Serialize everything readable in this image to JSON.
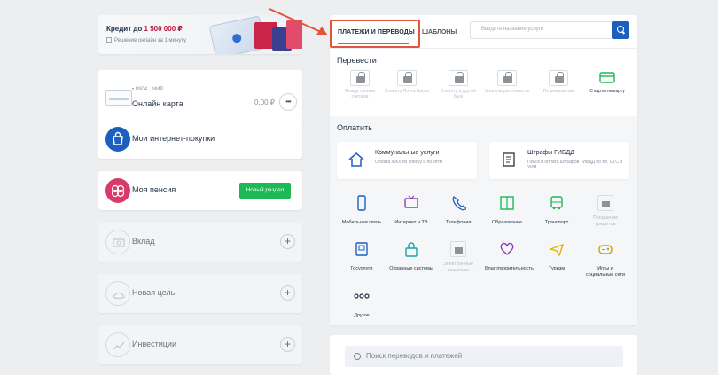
{
  "left": {
    "credit": {
      "title_prefix": "Кредит до ",
      "title_amount": "1 500 000 ₽",
      "subtitle": "Решение онлайн за 1 минуту"
    },
    "card": {
      "number": "• 8904 , МИР",
      "name": "Онлайн карта",
      "balance": "0,00 ₽",
      "more": "•••"
    },
    "purchases": {
      "label": "Мои интернет-покупки"
    },
    "pension": {
      "label": "Моя пенсия",
      "button": "Новый раздел"
    },
    "deposit": {
      "label": "Вклад"
    },
    "goal": {
      "label": "Новая цель"
    },
    "invest": {
      "label": "Инвестиции"
    }
  },
  "right": {
    "tabs": {
      "active": "ПЛАТЕЖИ И ПЕРЕВОДЫ",
      "second": "ШАБЛОНЫ"
    },
    "search_placeholder": "Введите название услуги",
    "transfer_title": "Перевести",
    "transfers": [
      {
        "label": "Между своими счетами"
      },
      {
        "label": "Клиенту Почта Банка"
      },
      {
        "label": "Клиенту в другой банк"
      },
      {
        "label": "Благотворительность"
      },
      {
        "label": "По реквизитам"
      },
      {
        "label": "С карты на карту"
      }
    ],
    "pay_title": "Оплатить",
    "utility": {
      "title": "Коммунальные услуги",
      "subtitle": "Оплата ЖКХ по списку и по ИНН"
    },
    "fines": {
      "title": "Штрафы ГИБДД",
      "subtitle": "Поиск и оплата штрафов ГИБДД по ВУ, СТС и УИН"
    },
    "services": [
      {
        "label": "Мобильная связь"
      },
      {
        "label": "Интернет и ТВ"
      },
      {
        "label": "Телефония"
      },
      {
        "label": "Образование"
      },
      {
        "label": "Транспорт"
      },
      {
        "label": "Погашение кредитов"
      },
      {
        "label": "Госуслуги"
      },
      {
        "label": "Охранные системы"
      },
      {
        "label": "Электронные кошельки"
      },
      {
        "label": "Благотворительность"
      },
      {
        "label": "Туризм"
      },
      {
        "label": "Игры и социальные сети"
      },
      {
        "label": "Другое"
      }
    ],
    "bottom_search": "Поиск переводов и платежей"
  },
  "colors": {
    "accent": "#1d5fbf",
    "highlight": "#e3553a",
    "green": "#1db954",
    "red": "#b8173a"
  }
}
